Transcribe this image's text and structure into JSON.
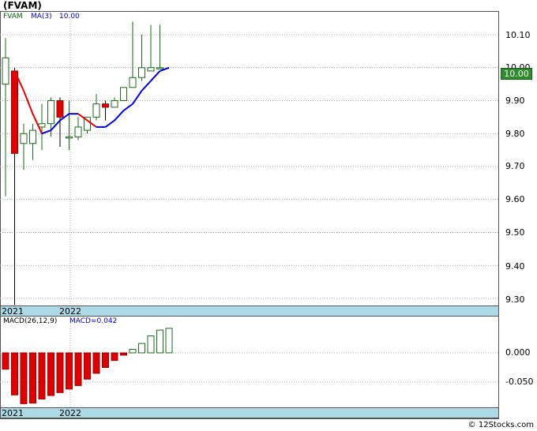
{
  "title": "(FVAM)",
  "chart_data": [
    {
      "type": "candlestick",
      "ticker": "FVAM",
      "legend": {
        "symbol": "FVAM",
        "ma_label": "MA(3)",
        "ma_value": "10.00"
      },
      "last_price": "10.00",
      "y_axis": {
        "ticks": [
          "10.10",
          "10.00",
          "9.90",
          "9.80",
          "9.70",
          "9.60",
          "9.50",
          "9.40",
          "9.30"
        ],
        "ylim": [
          9.275,
          10.17
        ]
      },
      "x_axis": {
        "year_labels": [
          "2021",
          "2022"
        ]
      },
      "grid": true,
      "candles": [
        {
          "o": 9.95,
          "h": 10.09,
          "l": 9.61,
          "c": 10.03
        },
        {
          "o": 9.99,
          "h": 10.0,
          "l": 9.28,
          "c": 9.74
        },
        {
          "o": 9.77,
          "h": 9.83,
          "l": 9.69,
          "c": 9.8
        },
        {
          "o": 9.77,
          "h": 9.83,
          "l": 9.72,
          "c": 9.81
        },
        {
          "o": 9.82,
          "h": 9.89,
          "l": 9.75,
          "c": 9.83
        },
        {
          "o": 9.83,
          "h": 9.91,
          "l": 9.79,
          "c": 9.9
        },
        {
          "o": 9.9,
          "h": 9.91,
          "l": 9.76,
          "c": 9.85
        },
        {
          "o": 9.79,
          "h": 9.9,
          "l": 9.75,
          "c": 9.79
        },
        {
          "o": 9.79,
          "h": 9.85,
          "l": 9.78,
          "c": 9.82
        },
        {
          "o": 9.81,
          "h": 9.85,
          "l": 9.8,
          "c": 9.85
        },
        {
          "o": 9.85,
          "h": 9.92,
          "l": 9.84,
          "c": 9.89
        },
        {
          "o": 9.89,
          "h": 9.9,
          "l": 9.84,
          "c": 9.88
        },
        {
          "o": 9.88,
          "h": 9.91,
          "l": 9.88,
          "c": 9.9
        },
        {
          "o": 9.9,
          "h": 9.94,
          "l": 9.9,
          "c": 9.94
        },
        {
          "o": 9.94,
          "h": 10.14,
          "l": 9.94,
          "c": 9.97
        },
        {
          "o": 9.97,
          "h": 10.1,
          "l": 9.96,
          "c": 10.0
        },
        {
          "o": 9.99,
          "h": 10.13,
          "l": 9.99,
          "c": 10.0
        },
        {
          "o": 10.0,
          "h": 10.13,
          "l": 10.0,
          "c": 10.0
        }
      ],
      "ma3": [
        null,
        9.99,
        9.93,
        9.86,
        9.8,
        9.81,
        9.84,
        9.86,
        9.86,
        9.84,
        9.82,
        9.82,
        9.84,
        9.87,
        9.89,
        9.93,
        9.96,
        9.99,
        10.0
      ]
    },
    {
      "type": "bar",
      "name": "MACD",
      "legend": {
        "label": "MACD(26,12,9)",
        "value_label": "MACD=0.042"
      },
      "y_axis": {
        "ticks": [
          "0.000",
          "-0.050"
        ],
        "ylim": [
          -0.09,
          0.05
        ]
      },
      "x_axis": {
        "year_labels": [
          "2021",
          "2022"
        ]
      },
      "values": [
        -0.028,
        -0.072,
        -0.087,
        -0.086,
        -0.079,
        -0.073,
        -0.068,
        -0.062,
        -0.056,
        -0.045,
        -0.035,
        -0.025,
        -0.013,
        -0.004,
        0.006,
        0.016,
        0.029,
        0.039,
        0.042
      ]
    }
  ],
  "footer": "© 12Stocks.com"
}
